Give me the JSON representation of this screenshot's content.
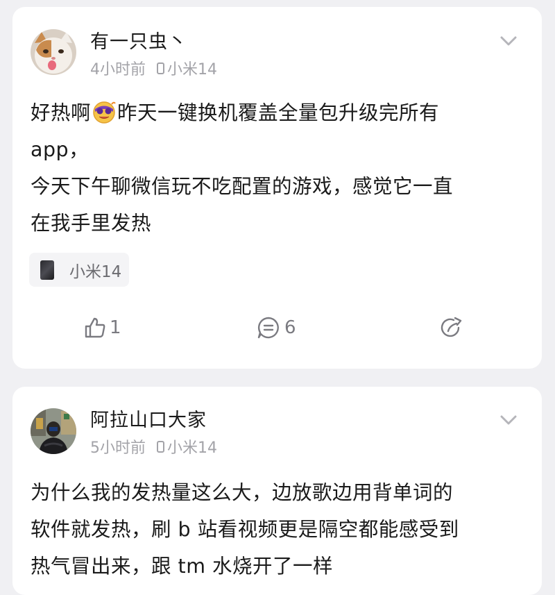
{
  "posts": [
    {
      "username": "有一只虫丶",
      "time": "4小时前",
      "device": "小米14",
      "content_line1_a": "好热啊",
      "content_line1_b": "昨天一键换机覆盖全量包升级完所有",
      "content_line2": "app，",
      "content_line3": "今天下午聊微信玩不吃配置的游戏，感觉它一直",
      "content_line4": "在我手里发热",
      "emoji": "hot-face-emoji",
      "device_tag": "小米14",
      "likes": "1",
      "comments": "6"
    },
    {
      "username": "阿拉山口大家",
      "time": "5小时前",
      "device": "小米14",
      "content_line1": "为什么我的发热量这么大，边放歌边用背单词的",
      "content_line2": "软件就发热，刷 b 站看视频更是隔空都能感受到",
      "content_line3": "热气冒出来，跟 tm 水烧开了一样"
    }
  ],
  "colors": {
    "background": "#f0f0f3",
    "card": "#ffffff",
    "meta_text": "#a3a3a8",
    "icon": "#7a7a80"
  }
}
